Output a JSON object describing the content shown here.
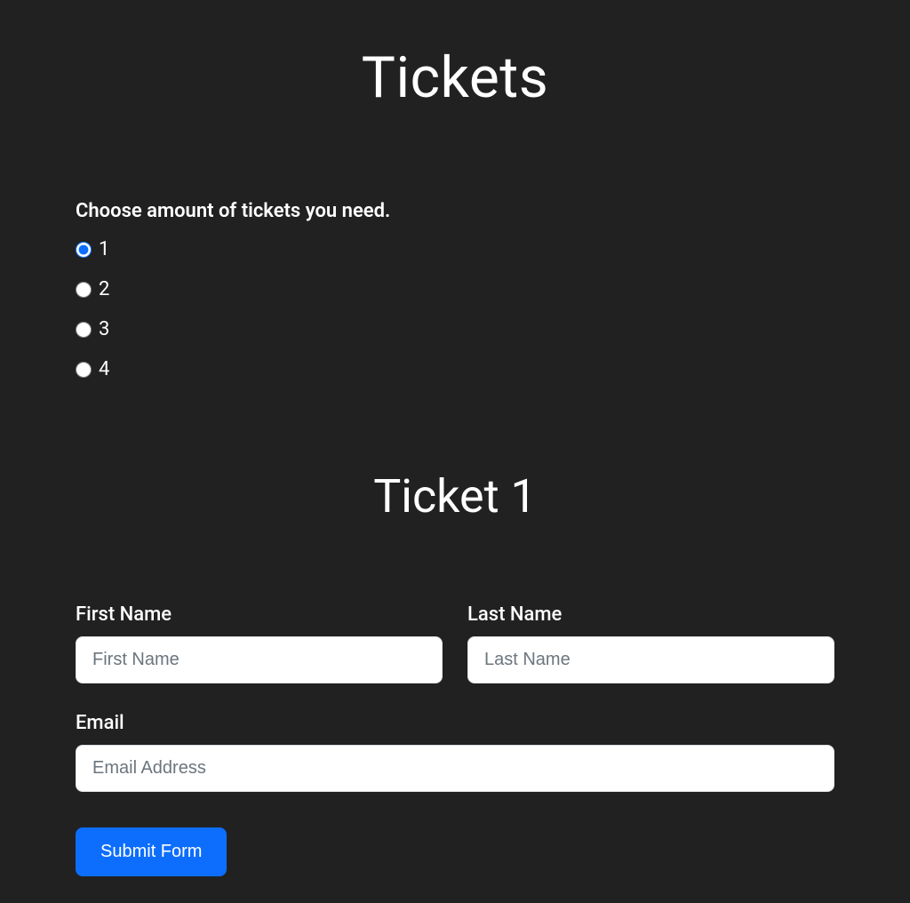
{
  "page": {
    "title": "Tickets",
    "prompt": "Choose amount of tickets you need."
  },
  "options": [
    {
      "label": "1",
      "selected": true
    },
    {
      "label": "2",
      "selected": false
    },
    {
      "label": "3",
      "selected": false
    },
    {
      "label": "4",
      "selected": false
    }
  ],
  "ticket_form": {
    "heading": "Ticket 1",
    "first_name": {
      "label": "First Name",
      "placeholder": "First Name",
      "value": ""
    },
    "last_name": {
      "label": "Last Name",
      "placeholder": "Last Name",
      "value": ""
    },
    "email": {
      "label": "Email",
      "placeholder": "Email Address",
      "value": ""
    },
    "submit_label": "Submit Form"
  }
}
